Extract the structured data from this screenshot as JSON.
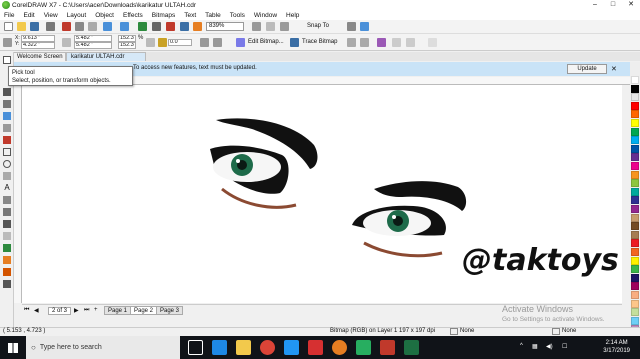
{
  "window": {
    "title": "CorelDRAW X7 - C:\\Users\\acer\\Downloads\\karikatur ULTAH.cdr",
    "controls": [
      "–",
      "□",
      "✕"
    ]
  },
  "menu": [
    "File",
    "Edit",
    "View",
    "Layout",
    "Object",
    "Effects",
    "Bitmaps",
    "Text",
    "Table",
    "Tools",
    "Window",
    "Help"
  ],
  "toolbar1": {
    "zoom": "839%",
    "snap_to": "Snap To"
  },
  "toolbar2": {
    "x": "9.613 \"",
    "y": "4.322 \"",
    "width": "5.482 \"",
    "height": "5.482 \"",
    "scale_w": "152.3",
    "scale_h": "152.3",
    "percent": "%",
    "rotation": "0.0",
    "edit_bitmap": "Edit Bitmap...",
    "trace_bitmap": "Trace Bitmap"
  },
  "tabs": {
    "welcome": "Welcome Screen",
    "document": "karikatur ULTAH.cdr"
  },
  "infobar": {
    "message": "To access new features, text must be updated.",
    "update_label": "Update"
  },
  "tooltip": {
    "title": "Pick tool",
    "description": "Select, position, or transform objects."
  },
  "canvas": {
    "signature": "@taktoys"
  },
  "pagenav": {
    "page_count": "2 of 3",
    "pages": [
      "Page 1",
      "Page 2",
      "Page 3"
    ]
  },
  "status": {
    "coords": "( 5.153 , 4.723 )",
    "object_info": "Bitmap (RGB) on Layer 1 197 x 197 dpi",
    "fill": "None",
    "outline": "None"
  },
  "watermark": {
    "line1": "Activate Windows",
    "line2": "Go to Settings to activate Windows."
  },
  "taskbar": {
    "search_placeholder": "Type here to search",
    "time": "2:14 AM",
    "date": "3/17/2019"
  },
  "colors": {
    "infobar": "#c9e3f7",
    "taskbar": "#101318",
    "eye_iris": "#1e6b4a",
    "lip_shadow": "#8b4a32"
  },
  "palette_right": [
    "#ffffff",
    "#000000",
    "#e6e6e6",
    "#ff0000",
    "#ff6600",
    "#ffff00",
    "#00a651",
    "#00aeef",
    "#0054a6",
    "#662d91",
    "#ec008c",
    "#f7941d",
    "#8dc63f",
    "#00a99d",
    "#2e3192",
    "#92278f",
    "#c69c6d",
    "#754c24",
    "#a67c52",
    "#ed1c24",
    "#f26522",
    "#fff200",
    "#39b54a",
    "#1b1464",
    "#9e005d",
    "#f9ad81",
    "#fdc689",
    "#c4df9b",
    "#6dcff6",
    "#bd8cbf",
    "#f49ac1"
  ],
  "palette_bottom": [
    "#ffffff",
    "#000000",
    "#333333",
    "#666666",
    "#999999",
    "#cccccc",
    "#ed1c24",
    "#f7941d",
    "#fff200",
    "#00a651",
    "#00aeef",
    "#2e3192",
    "#92278f",
    "#ec008c",
    "#8b5e3c",
    "#c49a6c",
    "#f5deb3",
    "#fbaf5d",
    "#8dc63f",
    "#00a99d",
    "#0072bc",
    "#662d91",
    "#9e0039",
    "#603913",
    "#c7b299",
    "#a3d39c",
    "#7accc8",
    "#6dcff6",
    "#8393ca",
    "#a186be",
    "#f49ac1",
    "#f26c4f",
    "#fdc68a",
    "#fff799",
    "#c4df9b",
    "#82ca9c",
    "#7bcdc8",
    "#6ecff6",
    "#7da7d9",
    "#8781bd",
    "#bd8cbf",
    "#f6989d",
    "#444444",
    "#777777",
    "#aaaaaa",
    "#dddddd"
  ]
}
